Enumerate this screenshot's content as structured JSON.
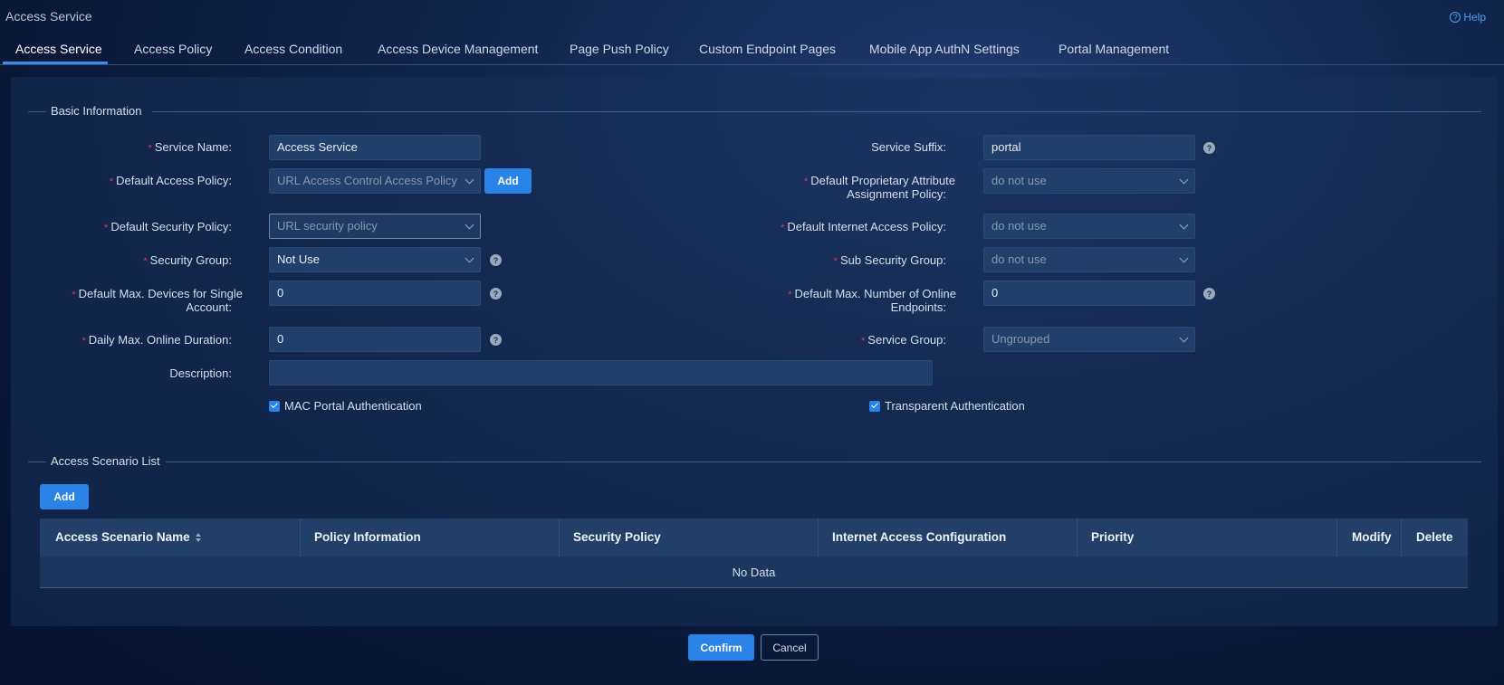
{
  "header": {
    "app_title": "Access Service",
    "help_label": "Help"
  },
  "tabs": [
    {
      "label": "Access Service"
    },
    {
      "label": "Access Policy"
    },
    {
      "label": "Access Condition"
    },
    {
      "label": "Access Device Management"
    },
    {
      "label": "Page Push Policy"
    },
    {
      "label": "Custom Endpoint Pages"
    },
    {
      "label": "Mobile App AuthN Settings"
    },
    {
      "label": "Portal Management"
    }
  ],
  "basic": {
    "title": "Basic Information",
    "service_name": {
      "label": "Service Name:",
      "value": "Access Service"
    },
    "service_suffix": {
      "label": "Service Suffix:",
      "value": "portal"
    },
    "default_access_policy": {
      "label": "Default Access Policy:",
      "value": "URL Access Control Access Policy",
      "add_label": "Add"
    },
    "default_proprietary": {
      "label_line1": "Default Proprietary Attribute",
      "label_line2": "Assignment Policy:",
      "value": "do not use"
    },
    "default_security_policy": {
      "label": "Default Security Policy:",
      "value": "URL security policy"
    },
    "default_internet_policy": {
      "label": "Default Internet Access Policy:",
      "value": "do not use"
    },
    "security_group": {
      "label": "Security Group:",
      "value": "Not Use"
    },
    "sub_security_group": {
      "label": "Sub Security Group:",
      "value": "do not use"
    },
    "max_devices": {
      "label_line1": "Default Max. Devices for Single",
      "label_line2": "Account:",
      "value": "0"
    },
    "max_online_endpoints": {
      "label_line1": "Default Max. Number of Online",
      "label_line2": "Endpoints:",
      "value": "0"
    },
    "daily_max_duration": {
      "label": "Daily Max. Online Duration:",
      "value": "0"
    },
    "service_group": {
      "label": "Service Group:",
      "value": "Ungrouped"
    },
    "description": {
      "label": "Description:",
      "value": ""
    },
    "mac_portal_auth": {
      "label": "MAC Portal Authentication",
      "checked": true
    },
    "transparent_auth": {
      "label": "Transparent Authentication",
      "checked": true
    }
  },
  "scenario": {
    "title": "Access Scenario List",
    "add_label": "Add",
    "columns": [
      "Access Scenario Name",
      "Policy Information",
      "Security Policy",
      "Internet Access Configuration",
      "Priority",
      "Modify",
      "Delete"
    ],
    "empty_text": "No Data"
  },
  "footer": {
    "confirm_label": "Confirm",
    "cancel_label": "Cancel"
  },
  "colors": {
    "accent": "#2a83e6",
    "required": "#e53a48",
    "panel": "#18305a"
  }
}
